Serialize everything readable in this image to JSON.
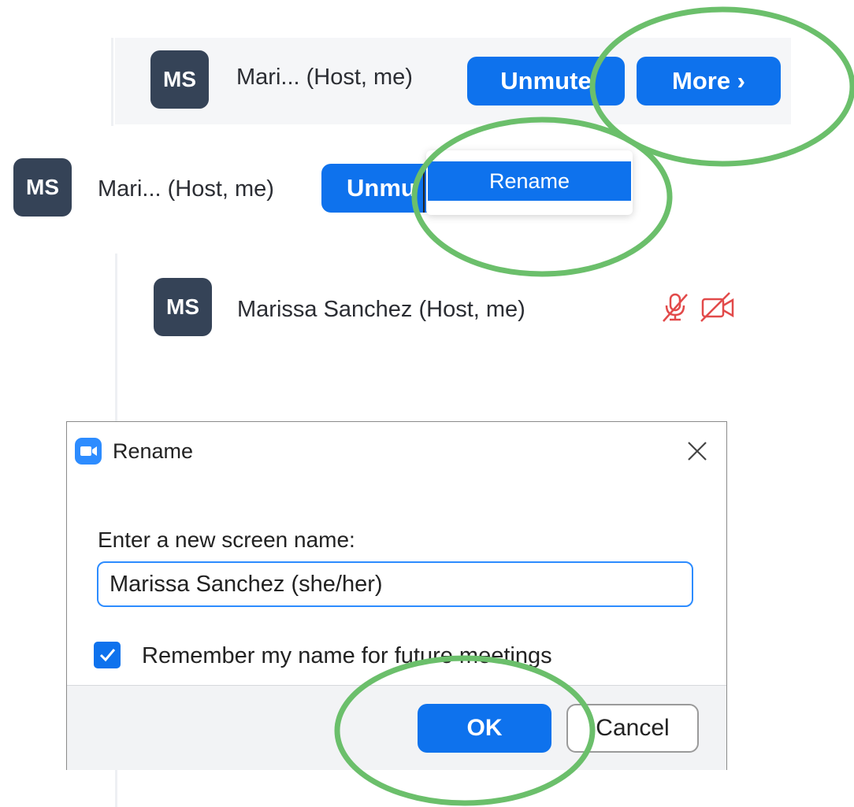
{
  "annotation_color": "#6bbf6b",
  "row1": {
    "avatar": "MS",
    "name": "Mari...  (Host, me)",
    "unmute_label": "Unmute",
    "more_label": "More ›"
  },
  "row2": {
    "avatar": "MS",
    "name": "Mari...  (Host, me)",
    "unmute_label": "Unmu",
    "menu_item": "Rename"
  },
  "row3": {
    "avatar": "MS",
    "name": "Marissa Sanchez (Host, me)",
    "icons": [
      "muted-microphone-icon",
      "camera-off-icon"
    ]
  },
  "dialog": {
    "title": "Rename",
    "prompt": "Enter a new screen name:",
    "input_value": "Marissa Sanchez (she/her)",
    "remember_label": "Remember my name for future meetings",
    "remember_checked": true,
    "ok_label": "OK",
    "cancel_label": "Cancel"
  }
}
